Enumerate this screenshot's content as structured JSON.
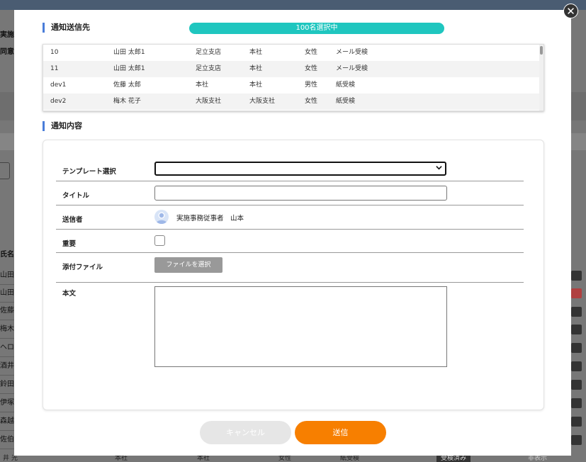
{
  "background": {
    "left_labels": [
      "実施ダ",
      "同意書"
    ],
    "column_header": "氏名 ≑",
    "names": [
      "山田",
      "山田",
      "佐藤",
      "梅木",
      "ヘロ",
      "酒井",
      "鈴田",
      "伊塚",
      "森越",
      "佐伯"
    ],
    "bottom_row": [
      "井 光",
      "本社",
      "本社",
      "女性",
      "紙受検",
      "受検済み",
      "非表示"
    ]
  },
  "modal": {
    "close_symbol": "✕",
    "recipients_title": "通知送信先",
    "selection_count": "100名選択中",
    "recipients": [
      {
        "id": "10",
        "name": "山田 太郎1",
        "branch": "足立支店",
        "office": "本社",
        "gender": "女性",
        "method": "メール受検"
      },
      {
        "id": "11",
        "name": "山田 太郎1",
        "branch": "足立支店",
        "office": "本社",
        "gender": "女性",
        "method": "メール受検"
      },
      {
        "id": "dev1",
        "name": "佐藤 太郎",
        "branch": "本社",
        "office": "本社",
        "gender": "男性",
        "method": "紙受検"
      },
      {
        "id": "dev2",
        "name": "梅木 花子",
        "branch": "大阪支社",
        "office": "大阪支社",
        "gender": "女性",
        "method": "紙受検"
      }
    ],
    "content_title": "通知内容",
    "form": {
      "template_label": "テンプレート選択",
      "template_value": "",
      "title_label": "タイトル",
      "title_value": "",
      "sender_label": "送信者",
      "sender_value": "実施事務従事者　山本",
      "important_label": "重要",
      "attachment_label": "添付ファイル",
      "file_button_label": "ファイルを選択",
      "body_label": "本文",
      "body_value": ""
    },
    "cancel_label": "キャンセル",
    "send_label": "送信"
  },
  "colors": {
    "accent_teal": "#1fc6bf",
    "send_orange": "#f77f00",
    "section_bar": "#4a7dd9"
  }
}
